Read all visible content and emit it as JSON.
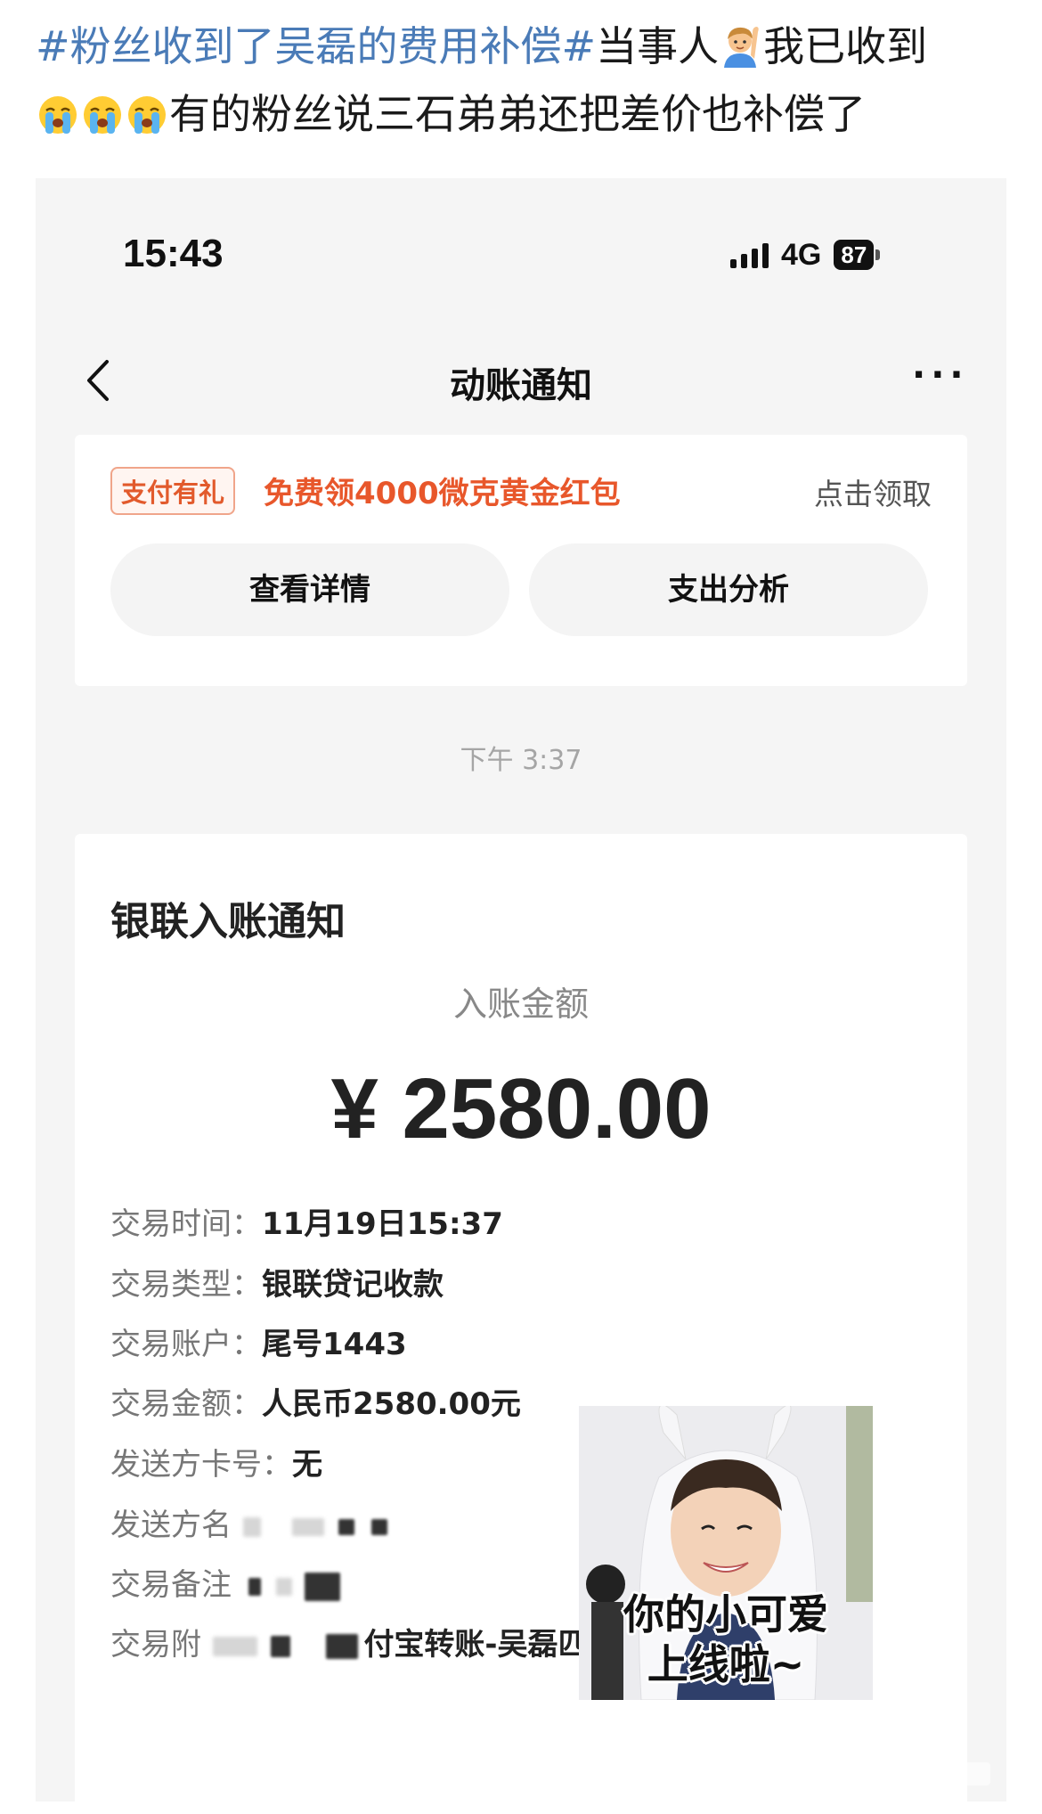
{
  "post": {
    "topic": "#粉丝收到了吴磊的费用补偿#",
    "text_part1": "当事人",
    "text_part2": "我已收到",
    "text_part3": "有的粉丝说三石弟弟还把差价也补偿了",
    "emoji_person": "person-raising-hand",
    "emoji_cry": "loudly-crying-face"
  },
  "status_bar": {
    "time": "15:43",
    "network": "4G",
    "battery": "87"
  },
  "nav": {
    "title": "动账通知",
    "more": "···"
  },
  "promo": {
    "badge": "支付有礼",
    "text": "免费领4000微克黄金红包",
    "claim": "点击领取",
    "button_details": "查看详情",
    "button_analysis": "支出分析"
  },
  "time_separator": "下午 3:37",
  "notice": {
    "title": "银联入账通知",
    "amount_label": "入账金额",
    "amount": "¥ 2580.00",
    "rows": [
      {
        "label": "交易时间：",
        "value": "11月19日15:37"
      },
      {
        "label": "交易类型：",
        "value": "银联贷记收款"
      },
      {
        "label": "交易账户：",
        "value": "尾号1443"
      },
      {
        "label": "交易金额：",
        "value": "人民币2580.00元"
      },
      {
        "label": "发送方卡号：",
        "value": "无"
      },
      {
        "label": "发送方名",
        "value": ""
      },
      {
        "label": "交易备注",
        "value": ""
      },
      {
        "label": "交易附",
        "value": "付宝转账-吴磊匹克活动补偿"
      }
    ]
  },
  "sticker": {
    "caption_line1": "你的小可爱",
    "caption_line2": "上线啦~"
  },
  "colors": {
    "topic_blue": "#4a7bb7",
    "promo_orange": "#e8572b",
    "page_bg": "#f5f5f5"
  }
}
